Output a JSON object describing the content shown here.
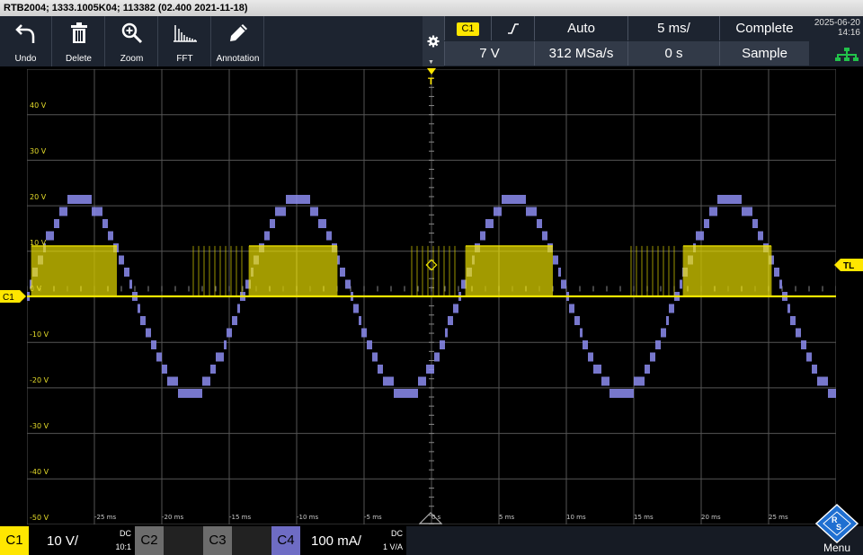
{
  "title": "RTB2004; 1333.1005K04; 113382 (02.400 2021-11-18)",
  "toolbar": {
    "tools": [
      {
        "label": "Undo",
        "icon": "undo-icon"
      },
      {
        "label": "Delete",
        "icon": "trash-icon"
      },
      {
        "label": "Zoom",
        "icon": "zoom-icon"
      },
      {
        "label": "FFT",
        "icon": "fft-icon"
      },
      {
        "label": "Annotation",
        "icon": "pencil-icon"
      }
    ],
    "settings_icon": "gear-icon"
  },
  "trigger": {
    "source": "C1",
    "slope_icon": "rising-edge-icon",
    "mode": "Auto",
    "level": "7 V",
    "samplerate": "312 MSa/s",
    "timebase": "5 ms/",
    "position": "0 s",
    "acq_state": "Complete",
    "acq_mode": "Sample"
  },
  "datetime": {
    "date": "2025-06-20",
    "time": "14:16"
  },
  "network_icon": "network-icon",
  "plot": {
    "voltage_labels": [
      "40 V",
      "30 V",
      "20 V",
      "10 V",
      "0 V",
      "-10 V",
      "-20 V",
      "-30 V",
      "-40 V",
      "-50 V"
    ],
    "time_labels": [
      "-25 ms",
      "-20 ms",
      "-15 ms",
      "-10 ms",
      "-5 ms",
      "0 s",
      "5 ms",
      "10 ms",
      "15 ms",
      "20 ms",
      "25 ms"
    ],
    "colors": {
      "c1": "#f2e600",
      "c4": "#8c8cf0",
      "grid": "#555555"
    },
    "c1_marker": "C1",
    "trigger_level_marker": "TL",
    "trigger_pos_marker": "T"
  },
  "channels": [
    {
      "tag": "C1",
      "scale": "10 V/",
      "coupling": "DC",
      "probe": "10:1",
      "color": "#ffe600",
      "active": true
    },
    {
      "tag": "C2",
      "scale": "",
      "coupling": "",
      "probe": "",
      "color": "#6c6c6c",
      "active": false
    },
    {
      "tag": "C3",
      "scale": "",
      "coupling": "",
      "probe": "",
      "color": "#6c6c6c",
      "active": false
    },
    {
      "tag": "C4",
      "scale": "100 mA/",
      "coupling": "DC",
      "probe": "1 V/A",
      "color": "#6e6cc4",
      "active": true
    }
  ],
  "menu": {
    "label": "Menu",
    "logo": "rohde-schwarz-logo"
  }
}
